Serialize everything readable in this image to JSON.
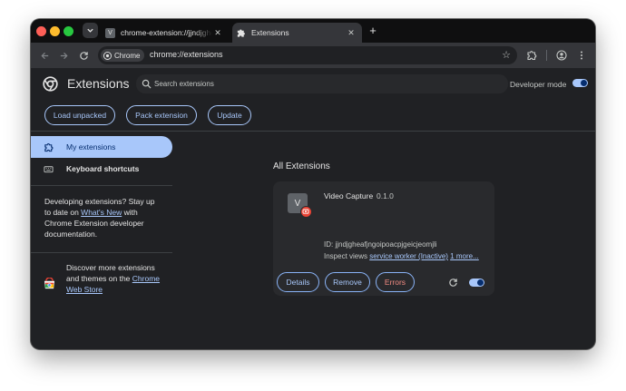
{
  "browser": {
    "tabs": [
      {
        "favicon_letter": "V",
        "title": "chrome-extension://jjndjgheafjngoipoacpjgeicjeomjli",
        "close": "✕"
      },
      {
        "title": "Extensions",
        "close": "✕"
      }
    ],
    "new_tab": "+",
    "omnibox": {
      "chip_label": "Chrome",
      "url": "chrome://extensions"
    },
    "icons": [
      "back-icon",
      "forward-icon",
      "reload-icon",
      "star-icon",
      "extensions-puzzle-icon",
      "profile-icon",
      "menu-icon"
    ]
  },
  "header": {
    "title": "Extensions",
    "search_placeholder": "Search extensions",
    "developer_mode_label": "Developer mode",
    "developer_mode_on": true,
    "buttons": {
      "load_unpacked": "Load unpacked",
      "pack_extension": "Pack extension",
      "update": "Update"
    }
  },
  "sidebar": {
    "items": [
      {
        "label": "My extensions",
        "selected": true
      },
      {
        "label": "Keyboard shortcuts",
        "selected": false
      }
    ],
    "developing": {
      "text1": "Developing extensions? Stay up to date on ",
      "link": "What's New",
      "text2": " with Chrome Extension developer documentation."
    },
    "webstore": {
      "text1": "Discover more extensions and themes on the ",
      "link": "Chrome Web Store"
    }
  },
  "main": {
    "section_title": "All Extensions",
    "extension": {
      "icon_letter": "V",
      "name": "Video Capture",
      "version": "0.1.0",
      "id_line": "ID: jjndjgheafjngoipoacpjgeicjeomjli",
      "inspect_label": "Inspect views ",
      "inspect_link": "service worker (Inactive)",
      "more_link": "1 more...",
      "buttons": {
        "details": "Details",
        "remove": "Remove",
        "errors": "Errors"
      },
      "enabled": true
    }
  },
  "colors": {
    "accent": "#a8c7fa",
    "background": "#202124",
    "card": "#292a2d",
    "errors": "#f28b82",
    "badge": "#ea4335"
  }
}
